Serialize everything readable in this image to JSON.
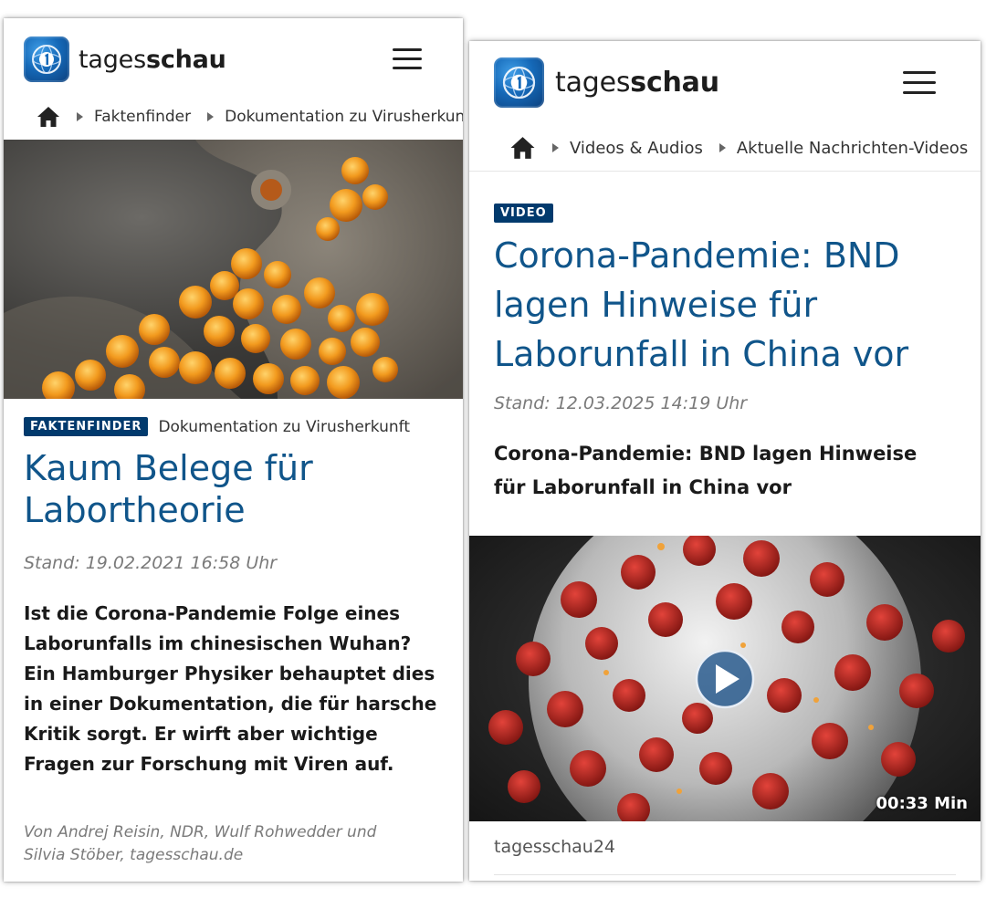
{
  "left": {
    "logo": {
      "text_light": "tages",
      "text_bold": "schau"
    },
    "breadcrumb": {
      "home_icon": "home-icon",
      "items": [
        "Faktenfinder",
        "Dokumentation zu Virusherkun"
      ]
    },
    "article": {
      "badge": "FAKTENFINDER",
      "topline": "Dokumentation zu Virusherkunft",
      "headline": "Kaum Belege für Labortheorie",
      "stand": "Stand: 19.02.2021 16:58 Uhr",
      "teaser": "Ist die Corona-Pandemie Folge eines Laborunfalls im chinesischen Wuhan? Ein Hamburger Physiker behauptet dies in einer Dokumentation, die für harsche Kritik sorgt. Er wirft aber wichtige Fragen zur Forschung mit Viren auf.",
      "byline": "Von Andrej Reisin, NDR, Wulf Rohwedder und Silvia Stöber, tagesschau.de"
    }
  },
  "right": {
    "logo": {
      "text_light": "tages",
      "text_bold": "schau"
    },
    "breadcrumb": {
      "home_icon": "home-icon",
      "items": [
        "Videos & Audios",
        "Aktuelle Nachrichten-Videos"
      ]
    },
    "article": {
      "badge": "VIDEO",
      "headline": "Corona-Pandemie: BND lagen Hinweise für Laborunfall in China vor",
      "stand": "Stand: 12.03.2025 14:19 Uhr",
      "teaser": "Corona-Pandemie: BND lagen Hinweise für Laborunfall in China vor",
      "video_duration": "00:33 Min",
      "source": "tagesschau24"
    }
  },
  "colors": {
    "brand_blue": "#013a6d",
    "headline_blue": "#10558a"
  }
}
